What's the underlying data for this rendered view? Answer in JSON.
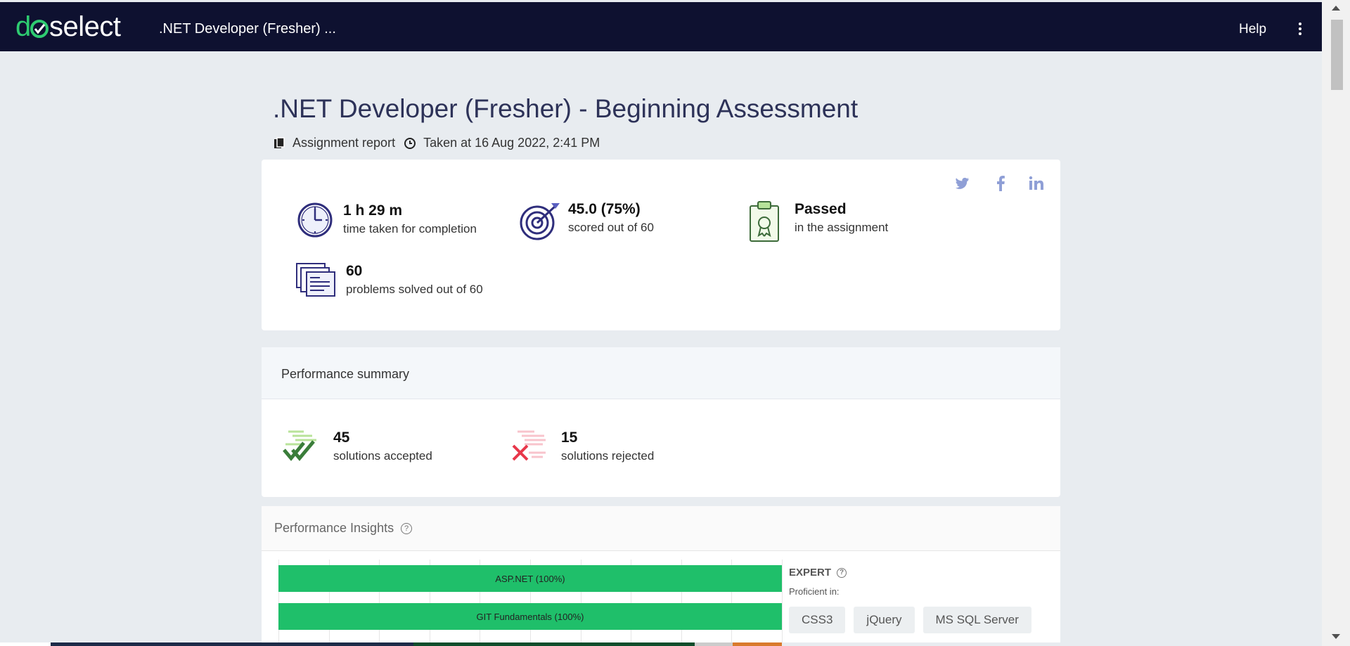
{
  "topbar": {
    "logo": "doselect",
    "title": ".NET Developer (Fresher) ...",
    "help": "Help"
  },
  "header": {
    "title": ".NET Developer (Fresher) - Beginning Assessment",
    "report_label": "Assignment report",
    "taken_at": "Taken at 16 Aug 2022, 2:41 PM"
  },
  "summary_stats": [
    {
      "value": "1 h 29 m",
      "label": "time taken for completion",
      "icon": "clock-icon"
    },
    {
      "value": "45.0 (75%)",
      "label": "scored out of 60",
      "icon": "target-icon"
    },
    {
      "value": "Passed",
      "label": "in the assignment",
      "icon": "clipboard-badge-icon"
    },
    {
      "value": "60",
      "label": "problems solved out of 60",
      "icon": "documents-icon"
    }
  ],
  "social": [
    "twitter-icon",
    "facebook-icon",
    "linkedin-icon"
  ],
  "performance_summary": {
    "title": "Performance summary",
    "accepted": {
      "value": "45",
      "label": "solutions accepted"
    },
    "rejected": {
      "value": "15",
      "label": "solutions rejected"
    }
  },
  "insights": {
    "title": "Performance Insights",
    "level": "EXPERT",
    "proficient_label": "Proficient in:",
    "skills": [
      "CSS3",
      "jQuery",
      "MS SQL Server"
    ]
  },
  "chart_data": {
    "type": "bar",
    "orientation": "horizontal",
    "categories": [
      "ASP.NET",
      "GIT Fundamentals"
    ],
    "bar_labels": [
      "ASP.NET (100%)",
      "GIT Fundamentals (100%)"
    ],
    "values": [
      100,
      100
    ],
    "xlim": [
      0,
      100
    ],
    "grid": true,
    "colors": [
      "#1fbf6a"
    ]
  },
  "colors": {
    "topbar": "#0e1130",
    "brand_green": "#2ecc71",
    "bar_green": "#1fbf6a",
    "title": "#2d3258"
  }
}
